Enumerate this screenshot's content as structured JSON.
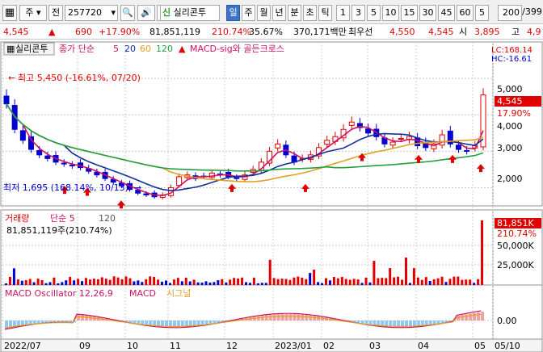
{
  "toolbar": {
    "logo_icon": "grid-icon",
    "market": "주",
    "type": "전",
    "code": "257720",
    "name": "실리콘투",
    "periods": [
      "일",
      "주",
      "월",
      "년",
      "분",
      "초",
      "틱"
    ],
    "active_period": "일",
    "nums": [
      "1",
      "3",
      "5",
      "10",
      "15",
      "30",
      "45",
      "60",
      "5"
    ],
    "count": "200",
    "total": "/399"
  },
  "quote": {
    "price": "4,545",
    "change": "690",
    "change_pct": "+17.90%",
    "volume": "81,851,119",
    "vol_ratio": "210.74%",
    "turnover": "35.67%",
    "amount": "370,171백만",
    "ref_label": "최우선",
    "ask": "4,550",
    "bid": "4,545",
    "open_label": "시",
    "open": "3,895",
    "high_label": "고",
    "high": "4,9"
  },
  "price_panel": {
    "title": "실리콘투",
    "ma_label": "종가 단순",
    "ma": [
      "5",
      "20",
      "60",
      "120"
    ],
    "signal": "MACD-sig와 골든크로스",
    "lc": "LC:168.14",
    "hc": "HC:-16.61",
    "max_note": "최고 5,450 (-16.61%, 07/20)",
    "min_note": "최저 1,695 (168.14%, 10/13)",
    "cur_price": "4,545",
    "cur_pct": "17.90%",
    "yticks": [
      "5,000",
      "4,000",
      "3,000",
      "2,000"
    ]
  },
  "volume_panel": {
    "title": "거래량",
    "ma_label": "단순 5",
    "ma_period": "120",
    "value_line": "81,851,119주(210.74%)",
    "cur": "81,851K",
    "cur_pct": "210.74%",
    "yticks": [
      "50,000K",
      "25,000K"
    ]
  },
  "macd_panel": {
    "title": "MACD Oscillator 12,26,9",
    "macd": "MACD",
    "signal": "시그널",
    "ytick": "0.00"
  },
  "xaxis": [
    "2022/07",
    "09",
    "10",
    "11",
    "12",
    "2023/01",
    "02",
    "03",
    "04",
    "05",
    "05/10"
  ],
  "colors": {
    "up": "#e00000",
    "down": "#0000d0",
    "ma5": "#d01060",
    "ma20": "#1030a0",
    "ma60": "#e0a020",
    "ma120": "#20a040"
  },
  "chart_data": {
    "type": "candlestick",
    "x_range": [
      "2022/07",
      "2023/05/10"
    ],
    "ylim": [
      1500,
      5600
    ],
    "x_tick_labels": [
      "2022/07",
      "09",
      "10",
      "11",
      "12",
      "2023/01",
      "02",
      "03",
      "04",
      "05",
      "05/10"
    ],
    "y_tick_labels": [
      "5,000",
      "4,000",
      "3,000",
      "2,000"
    ],
    "price_series": {
      "name": "close",
      "values": [
        4300,
        3600,
        3300,
        3050,
        2900,
        2800,
        2700,
        2650,
        2600,
        2550,
        2450,
        2350,
        2250,
        2150,
        2050,
        1950,
        1850,
        1800,
        1750,
        1800,
        2000,
        2300,
        2350,
        2250,
        2300,
        2400,
        2350,
        2300,
        2250,
        2350,
        2500,
        2700,
        3000,
        3200,
        2900,
        2700,
        2800,
        2900,
        3100,
        3300,
        3400,
        3600,
        3800,
        3650,
        3500,
        3400,
        3200,
        3250,
        3350,
        3400,
        3150,
        3100,
        3200,
        3450,
        3200,
        3050,
        3000,
        3150,
        4545
      ]
    },
    "max_marker": {
      "price": 5450,
      "pct": -16.61,
      "date": "07/20"
    },
    "min_marker": {
      "price": 1695,
      "pct": 168.14,
      "date": "10/13"
    },
    "volume_ylim": [
      0,
      90000
    ],
    "volume_latest_k": 81851,
    "macd_ytick": 0.0
  }
}
